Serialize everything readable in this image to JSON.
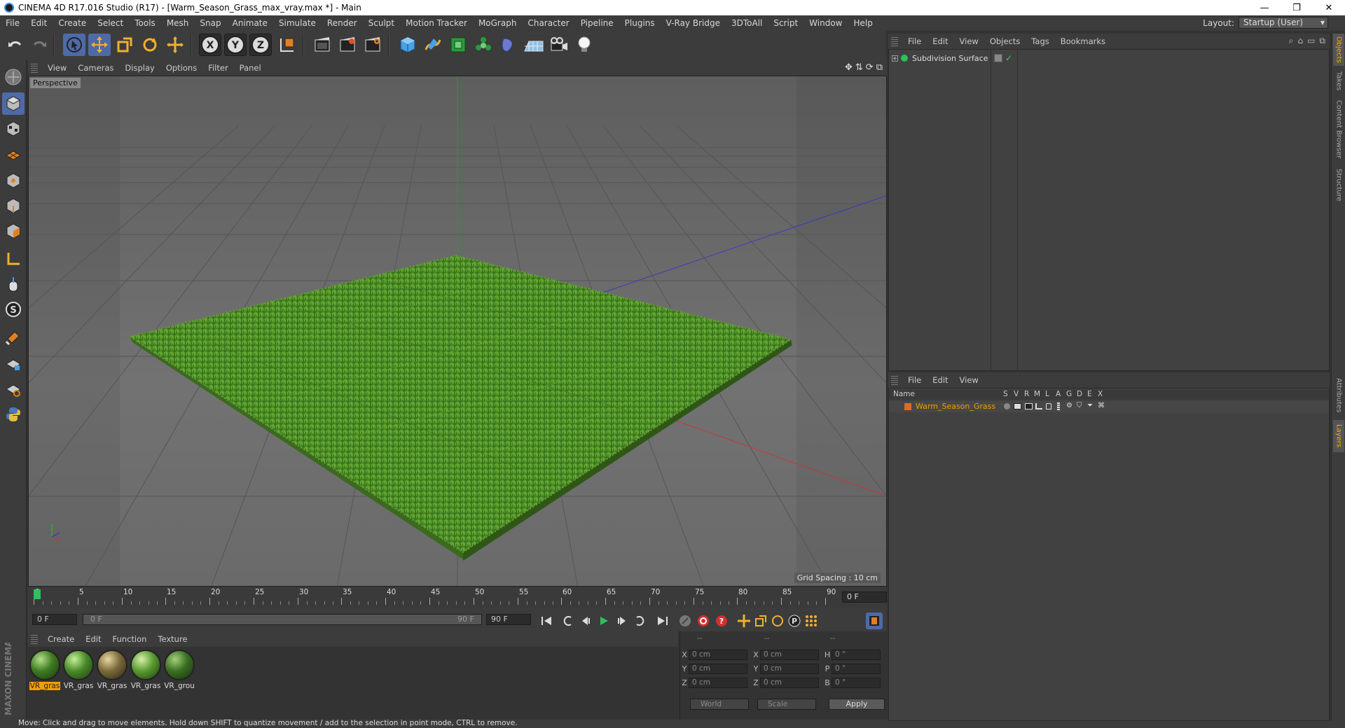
{
  "window": {
    "title": "CINEMA 4D R17.016 Studio (R17) - [Warm_Season_Grass_max_vray.max *] - Main",
    "minimize": "—",
    "maximize": "❐",
    "close": "✕"
  },
  "menubar": {
    "items": [
      "File",
      "Edit",
      "Create",
      "Select",
      "Tools",
      "Mesh",
      "Snap",
      "Animate",
      "Simulate",
      "Render",
      "Sculpt",
      "Motion Tracker",
      "MoGraph",
      "Character",
      "Pipeline",
      "Plugins",
      "V-Ray Bridge",
      "3DToAll",
      "Script",
      "Window",
      "Help"
    ],
    "layout_label": "Layout:",
    "layout_value": "Startup (User)"
  },
  "toolbar": {
    "icons": [
      "undo-icon",
      "redo-icon",
      "live-selection-icon",
      "move-icon",
      "scale-icon",
      "rotate-icon",
      "last-tool-icon",
      "x-axis-icon",
      "y-axis-icon",
      "z-axis-icon",
      "coordinate-system-icon",
      "render-view-icon",
      "render-picture-viewer-icon",
      "edit-render-settings-icon",
      "cube-icon",
      "pen-spline-icon",
      "subdivision-icon",
      "cloner-icon",
      "deformer-icon",
      "floor-icon",
      "camera-icon",
      "light-icon"
    ],
    "axis_x": "X",
    "axis_y": "Y",
    "axis_z": "Z"
  },
  "viewport": {
    "menu": [
      "View",
      "Cameras",
      "Display",
      "Options",
      "Filter",
      "Panel"
    ],
    "label": "Perspective",
    "grid_spacing": "Grid Spacing : 10 cm"
  },
  "timeline": {
    "ticks": [
      "0",
      "5",
      "10",
      "15",
      "20",
      "25",
      "30",
      "35",
      "40",
      "45",
      "50",
      "55",
      "60",
      "65",
      "70",
      "75",
      "80",
      "85",
      "90"
    ],
    "current_frame": "0 F"
  },
  "playbar": {
    "start": "0 F",
    "range_start": "0 F",
    "range_end": "90 F",
    "end": "90 F"
  },
  "materials": {
    "menu": [
      "Create",
      "Edit",
      "Function",
      "Texture"
    ],
    "items": [
      {
        "label": "VR_gras",
        "color": "#3e7a22"
      },
      {
        "label": "VR_gras",
        "color": "#4a8a2a"
      },
      {
        "label": "VR_gras",
        "color": "#7a6a3a"
      },
      {
        "label": "VR_gras",
        "color": "#5a9a30"
      },
      {
        "label": "VR_grou",
        "color": "#3a6e22"
      }
    ]
  },
  "coords": {
    "header": [
      "--",
      "--",
      "--"
    ],
    "rows": [
      {
        "axis": "X",
        "pos": "0 cm",
        "axis2": "X",
        "size": "0 cm",
        "rot_axis": "H",
        "rot": "0 °"
      },
      {
        "axis": "Y",
        "pos": "0 cm",
        "axis2": "Y",
        "size": "0 cm",
        "rot_axis": "P",
        "rot": "0 °"
      },
      {
        "axis": "Z",
        "pos": "0 cm",
        "axis2": "Z",
        "size": "0 cm",
        "rot_axis": "B",
        "rot": "0 °"
      }
    ],
    "mode1": "World",
    "mode2": "Scale",
    "apply": "Apply"
  },
  "objects": {
    "menu": [
      "File",
      "Edit",
      "View",
      "Objects",
      "Tags",
      "Bookmarks"
    ],
    "item": "Subdivision Surface"
  },
  "layers": {
    "menu": [
      "File",
      "Edit",
      "View"
    ],
    "columns": [
      "Name",
      "S",
      "V",
      "R",
      "M",
      "L",
      "A",
      "G",
      "D",
      "E",
      "X"
    ],
    "item": "Warm_Season_Grass"
  },
  "side_tabs": [
    "Objects",
    "Takes",
    "Content Browser",
    "Structure",
    "Attributes",
    "Layers"
  ],
  "status": "Move: Click and drag to move elements. Hold down SHIFT to quantize movement / add to the selection in point mode, CTRL to remove.",
  "brand": "MAXON CINEMA 4D",
  "colors": {
    "accent": "#4f6aa8",
    "highlight": "#f0a000",
    "grass": "#4a8f28"
  }
}
